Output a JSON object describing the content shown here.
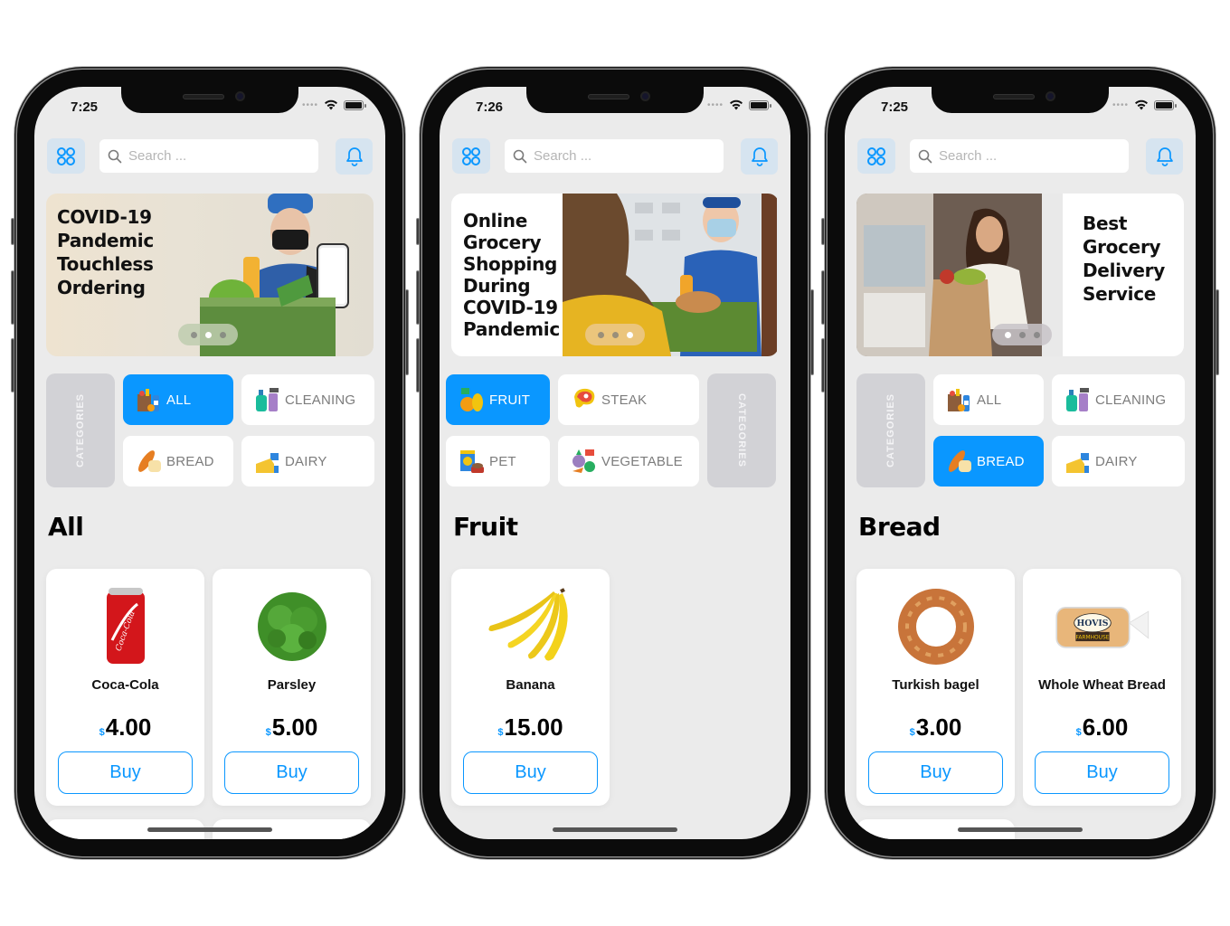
{
  "colors": {
    "accent": "#0a97ff",
    "screen_bg": "#ebebeb",
    "icon_btn_bg": "#d6e4f0",
    "categories_label_bg": "#d2d2d6"
  },
  "phones": [
    {
      "status": {
        "time": "7:25"
      },
      "topbar": {
        "menu_icon": "grid-four-circles-icon",
        "search_placeholder": "Search ...",
        "bell_icon": "bell-icon"
      },
      "banner": {
        "text": "COVID-19 Pandemic Touchless Ordering",
        "lines": [
          "COVID-19",
          "Pandemic",
          "Touchless",
          "Ordering"
        ],
        "image": "delivery-woman-with-phone-and-groceries",
        "dots": 3,
        "active_dot": 2
      },
      "categories": {
        "label": "CATEGORIES",
        "items": [
          {
            "label": "ALL",
            "icon": "grocery-bag-icon",
            "active": true
          },
          {
            "label": "CLEANING",
            "icon": "cleaning-bottles-icon",
            "active": false
          },
          {
            "label": "BREAD",
            "icon": "bread-icon",
            "active": false
          },
          {
            "label": "DAIRY",
            "icon": "cheese-milk-icon",
            "active": false
          }
        ]
      },
      "section_title": "All",
      "products": [
        {
          "name": "Coca-Cola",
          "currency": "$",
          "price": "4.00",
          "buy_label": "Buy",
          "image": "coca-cola-can"
        },
        {
          "name": "Parsley",
          "currency": "$",
          "price": "5.00",
          "buy_label": "Buy",
          "image": "parsley-bunch"
        }
      ]
    },
    {
      "status": {
        "time": "7:26"
      },
      "topbar": {
        "menu_icon": "grid-four-circles-icon",
        "search_placeholder": "Search ...",
        "bell_icon": "bell-icon"
      },
      "banner": {
        "text": "Online Grocery Shopping During COVID-19 Pandemic",
        "lines": [
          "Online",
          "Grocery",
          "Shopping",
          "During",
          "COVID-19",
          "Pandemic"
        ],
        "image": "courier-handing-groceries",
        "dots": 3,
        "active_dot": 3
      },
      "categories": {
        "label": "CATEGORIES",
        "items": [
          {
            "label": "FRUIT",
            "icon": "fruit-icon",
            "active": true
          },
          {
            "label": "STEAK",
            "icon": "steak-icon",
            "active": false
          },
          {
            "label": "PET",
            "icon": "pet-food-icon",
            "active": false
          },
          {
            "label": "VEGETABLE",
            "icon": "vegetable-icon",
            "active": false
          }
        ]
      },
      "section_title": "Fruit",
      "products": [
        {
          "name": "Banana",
          "currency": "$",
          "price": "15.00",
          "buy_label": "Buy",
          "image": "banana-bunch"
        }
      ]
    },
    {
      "status": {
        "time": "7:25"
      },
      "topbar": {
        "menu_icon": "grid-four-circles-icon",
        "search_placeholder": "Search ...",
        "bell_icon": "bell-icon"
      },
      "banner": {
        "text": "Best Grocery Delivery Service",
        "lines": [
          "Best",
          "Grocery",
          "Delivery",
          "Service"
        ],
        "image": "woman-with-paper-grocery-bag",
        "dots": 3,
        "active_dot": 1
      },
      "categories": {
        "label": "CATEGORIES",
        "items": [
          {
            "label": "ALL",
            "icon": "grocery-bag-icon",
            "active": false
          },
          {
            "label": "CLEANING",
            "icon": "cleaning-bottles-icon",
            "active": false
          },
          {
            "label": "BREAD",
            "icon": "bread-icon",
            "active": true
          },
          {
            "label": "DAIRY",
            "icon": "cheese-milk-icon",
            "active": false
          }
        ]
      },
      "section_title": "Bread",
      "products": [
        {
          "name": "Turkish bagel",
          "currency": "$",
          "price": "3.00",
          "buy_label": "Buy",
          "image": "simit-bagel"
        },
        {
          "name": "Whole Wheat Bread",
          "currency": "$",
          "price": "6.00",
          "buy_label": "Buy",
          "image": "hovis-farmhouse-loaf"
        }
      ]
    }
  ]
}
